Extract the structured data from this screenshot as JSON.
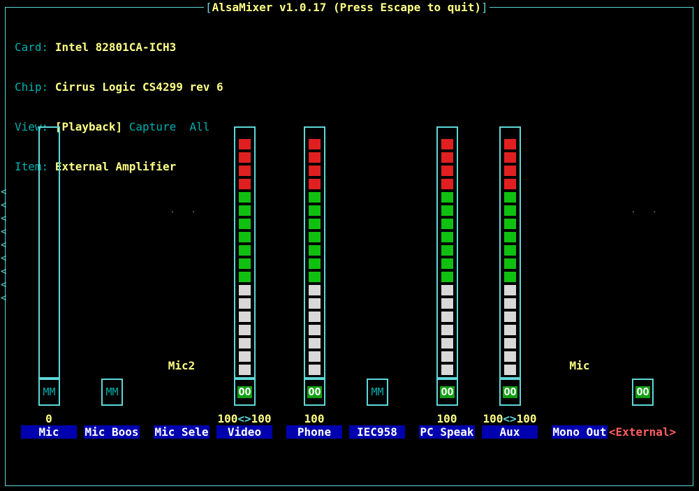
{
  "window": {
    "title": "AlsaMixer v1.0.17 (Press Escape to quit)",
    "bracket_left": "[",
    "bracket_right": "]"
  },
  "info": {
    "card_label": "Card:",
    "card_value": "Intel 82801CA-ICH3",
    "chip_label": "Chip:",
    "chip_value": "Cirrus Logic CS4299 rev 6",
    "view_label": "View:",
    "view_playback": "[Playback]",
    "view_capture": "Capture",
    "view_all": "All",
    "item_label": "Item:",
    "item_value": "External Amplifier"
  },
  "scroll_arrow": "<",
  "controls": [
    {
      "name": "Mic",
      "type": "gauge",
      "level": 0,
      "switch": "MM",
      "value": "0"
    },
    {
      "name": "Mic Boos",
      "type": "switch",
      "switch": "MM"
    },
    {
      "name": "Mic Sele",
      "type": "enum",
      "enum_value": "Mic2"
    },
    {
      "name": "Video",
      "type": "gauge",
      "level": 100,
      "switch": "OO",
      "value_left": "100",
      "value_sep": "<>",
      "value_right": "100"
    },
    {
      "name": "Phone",
      "type": "gauge",
      "level": 100,
      "switch": "OO",
      "value": "100"
    },
    {
      "name": "IEC958",
      "type": "switch",
      "switch": "MM"
    },
    {
      "name": "PC Speak",
      "type": "gauge",
      "level": 100,
      "switch": "OO",
      "value": "100"
    },
    {
      "name": "Aux",
      "type": "gauge",
      "level": 100,
      "switch": "OO",
      "value_left": "100",
      "value_sep": "<>",
      "value_right": "100"
    },
    {
      "name": "Mono Out",
      "type": "enum",
      "enum_value": "Mic"
    },
    {
      "name": "<External>",
      "type": "switch",
      "switch": "OO",
      "selected": true
    }
  ],
  "colors": {
    "border": "#5fd7d7",
    "label": "#00afaf",
    "value": "#ffff87",
    "name_bg": "#0000af",
    "selected": "#ff5f5f",
    "level_red": "#e02020",
    "level_green": "#10c010",
    "level_white": "#d8d8d8"
  }
}
